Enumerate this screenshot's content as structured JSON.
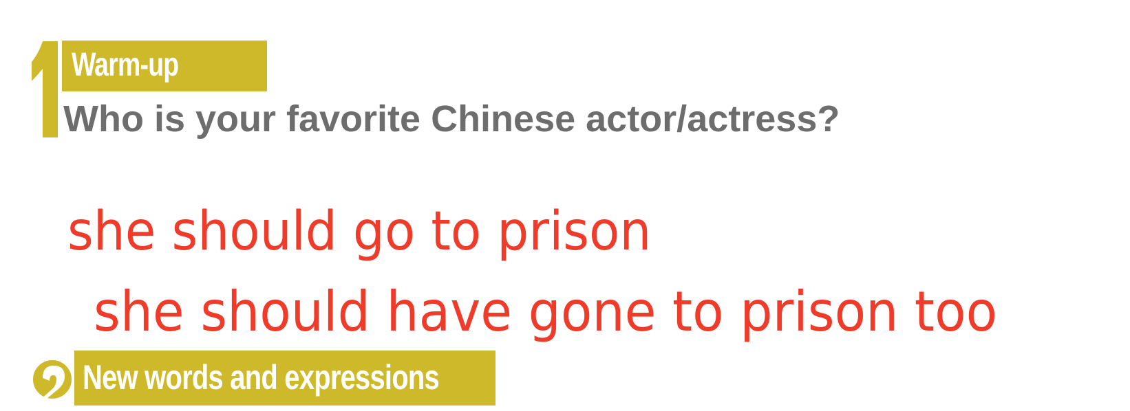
{
  "section1": {
    "number": "1",
    "banner_title": "Warm-up",
    "question": "Who is your favorite Chinese actor/actress?"
  },
  "notes": [
    "she should go to prison",
    "she should have gone to prison too"
  ],
  "section2": {
    "number": "2",
    "banner_title": "New words and expressions"
  },
  "colors": {
    "accent_gold": "#cdb929",
    "heading_gray": "#6d6d6d",
    "note_red": "#ef3b2a"
  }
}
